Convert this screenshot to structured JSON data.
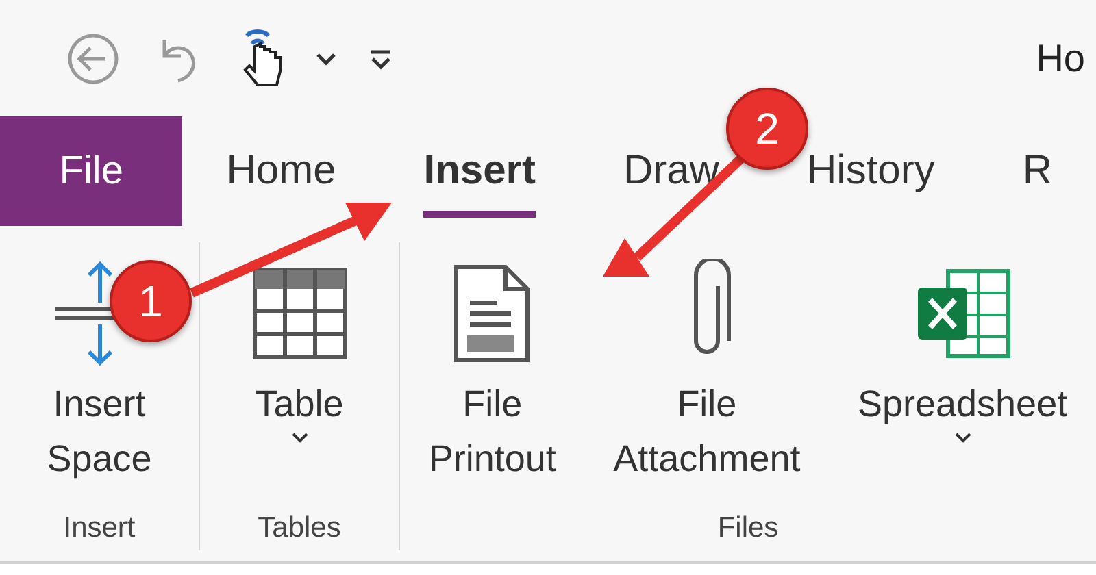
{
  "quick_access": {
    "title": "Ho",
    "buttons": [
      {
        "kind": "back"
      },
      {
        "kind": "undo"
      },
      {
        "kind": "touch"
      },
      {
        "kind": "caret"
      },
      {
        "kind": "customize"
      }
    ]
  },
  "tabs": [
    {
      "label": "File",
      "kind": "file",
      "selected": false
    },
    {
      "label": "Home",
      "kind": "tab",
      "selected": false
    },
    {
      "label": "Insert",
      "kind": "tab",
      "selected": true
    },
    {
      "label": "Draw",
      "kind": "tab",
      "selected": false
    },
    {
      "label": "History",
      "kind": "tab",
      "selected": false
    },
    {
      "label": "R",
      "kind": "tab",
      "selected": false
    }
  ],
  "groups": [
    {
      "label": "Insert",
      "commands": [
        {
          "kind": "insert-space",
          "lines": [
            "Insert",
            "Space"
          ],
          "dropdown": false
        }
      ]
    },
    {
      "label": "Tables",
      "commands": [
        {
          "kind": "table",
          "lines": [
            "Table"
          ],
          "dropdown": true
        }
      ]
    },
    {
      "label": "Files",
      "commands": [
        {
          "kind": "printout",
          "lines": [
            "File",
            "Printout"
          ],
          "dropdown": false
        },
        {
          "kind": "attachment",
          "lines": [
            "File",
            "Attachment"
          ],
          "dropdown": false
        },
        {
          "kind": "spreadsheet",
          "lines": [
            "Spreadsheet"
          ],
          "dropdown": true
        }
      ]
    }
  ],
  "annotations": [
    {
      "number": "1"
    },
    {
      "number": "2"
    }
  ]
}
